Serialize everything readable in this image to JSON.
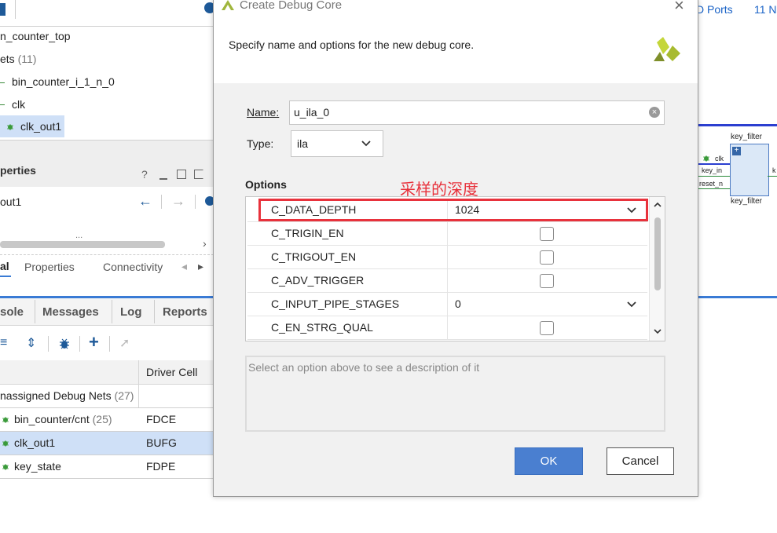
{
  "background": {
    "top_ports_link": "D Ports",
    "top_nets_link": "11 N",
    "tree": {
      "top": "n_counter_top",
      "nets_label": "ets",
      "nets_count": "(11)",
      "items": [
        "bin_counter_i_1_n_0",
        "clk",
        "clk_out1"
      ]
    },
    "properties": {
      "title": "perties",
      "object_name": "out1",
      "truncated_text": "...",
      "tabs": [
        "al",
        "Properties",
        "Connectivity"
      ]
    },
    "console_tabs": [
      "sole",
      "Messages",
      "Log",
      "Reports"
    ],
    "table": {
      "driver_header": "Driver Cell",
      "group_label": "nassigned Debug Nets",
      "group_count": "(27)",
      "rows": [
        {
          "name": "bin_counter/cnt",
          "count": "(25)",
          "driver": "FDCE"
        },
        {
          "name": "clk_out1",
          "count": "",
          "driver": "BUFG"
        },
        {
          "name": "key_state",
          "count": "",
          "driver": "FDPE"
        }
      ]
    },
    "schematic": {
      "block_title": "key_filter",
      "block_footer": "key_filter",
      "ports": [
        "clk",
        "key_in",
        "reset_n"
      ],
      "out_port": "k",
      "plus": "+"
    }
  },
  "dialog": {
    "title": "Create Debug Core",
    "description": "Specify name and options for the new debug core.",
    "name_label": "Name:",
    "name_value": "u_ila_0",
    "type_label": "Type:",
    "type_value": "ila",
    "options_heading": "Options",
    "annotation": "采样的深度",
    "annotation_color": "#e8323c",
    "options": [
      {
        "name": "C_DATA_DEPTH",
        "value": "1024",
        "kind": "dropdown"
      },
      {
        "name": "C_TRIGIN_EN",
        "value": "",
        "kind": "checkbox",
        "checked": false
      },
      {
        "name": "C_TRIGOUT_EN",
        "value": "",
        "kind": "checkbox",
        "checked": false
      },
      {
        "name": "C_ADV_TRIGGER",
        "value": "",
        "kind": "checkbox",
        "checked": false
      },
      {
        "name": "C_INPUT_PIPE_STAGES",
        "value": "0",
        "kind": "dropdown"
      },
      {
        "name": "C_EN_STRG_QUAL",
        "value": "",
        "kind": "checkbox",
        "checked": false
      }
    ],
    "description_placeholder": "Select an option above to see a description of it",
    "ok_label": "OK",
    "cancel_label": "Cancel",
    "accent_color": "#4a7fd0"
  }
}
